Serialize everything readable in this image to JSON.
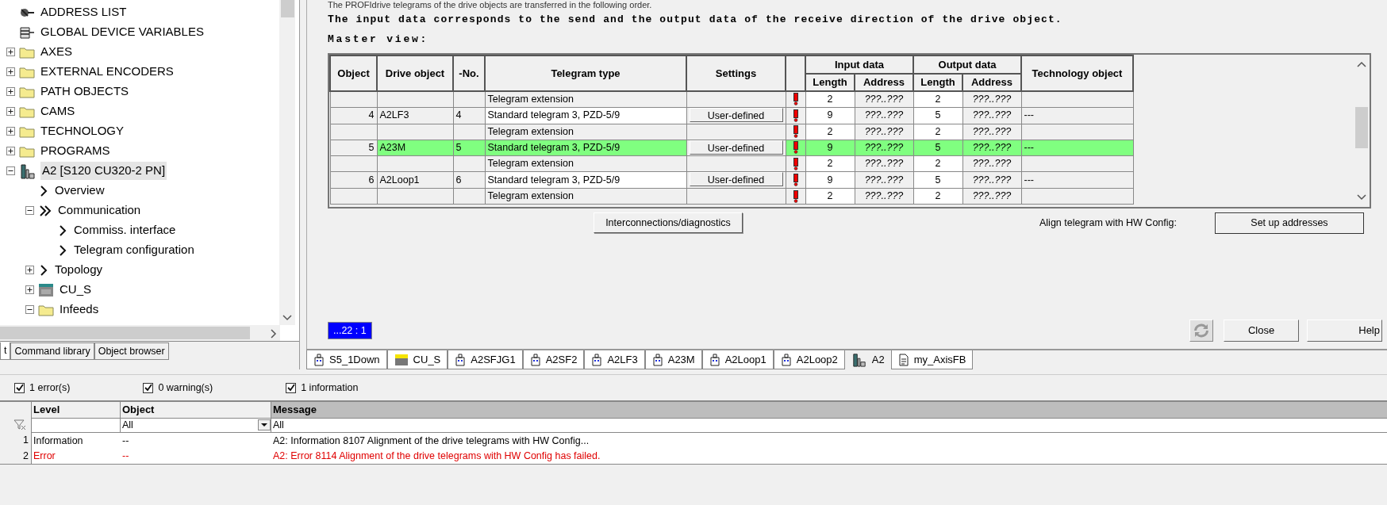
{
  "tree": [
    {
      "label": "ADDRESS LIST",
      "kind": "address"
    },
    {
      "label": "GLOBAL DEVICE VARIABLES",
      "kind": "database"
    },
    {
      "label": "AXES",
      "kind": "folder",
      "expanded": false
    },
    {
      "label": "EXTERNAL ENCODERS",
      "kind": "folder",
      "expanded": false
    },
    {
      "label": "PATH OBJECTS",
      "kind": "folder",
      "expanded": false
    },
    {
      "label": "CAMS",
      "kind": "folder",
      "expanded": false
    },
    {
      "label": "TECHNOLOGY",
      "kind": "folder",
      "expanded": false
    },
    {
      "label": "PROGRAMS",
      "kind": "folder",
      "expanded": false
    },
    {
      "label": "A2 [S120 CU320-2 PN]",
      "kind": "device",
      "expanded": true,
      "selected": true,
      "children": [
        {
          "label": "Overview",
          "kind": "view"
        },
        {
          "label": "Communication",
          "kind": "group",
          "expanded": true,
          "children": [
            {
              "label": "Commiss. interface",
              "kind": "view"
            },
            {
              "label": "Telegram configuration",
              "kind": "view"
            }
          ]
        },
        {
          "label": "Topology",
          "kind": "view",
          "expanded": false
        },
        {
          "label": "CU_S",
          "kind": "cu",
          "expanded": false
        },
        {
          "label": "Infeeds",
          "kind": "folder",
          "expanded": true
        }
      ]
    }
  ],
  "left_tabs": [
    {
      "label": "t",
      "selected": true
    },
    {
      "label": "Command library",
      "selected": false
    },
    {
      "label": "Object browser",
      "selected": false
    }
  ],
  "intro_lines": [
    "The PROFIdrive telegrams of the drive objects are transferred in the following order.",
    "The input data corresponds to the send and the output data of the receive direction of the drive object.",
    "Master view:"
  ],
  "table": {
    "columns": [
      "Object",
      "Drive object",
      "-No.",
      "Telegram type",
      "Settings",
      "Input data",
      "Output data",
      "Technology object"
    ],
    "subcolumns": [
      "Length",
      "Address",
      "Length",
      "Address"
    ],
    "rows": [
      {
        "kind": "extension",
        "object": "",
        "drive_object": "",
        "no": "",
        "telegram_type": "Telegram extension",
        "in_len": "2",
        "in_addr": "???..???",
        "out_len": "2",
        "out_addr": "???..???",
        "tech": "",
        "selected": false
      },
      {
        "kind": "main",
        "object": "4",
        "drive_object": "A2LF3",
        "no": "4",
        "telegram_type": "Standard telegram 3, PZD-5/9",
        "settings": "User-defined",
        "in_len": "9",
        "in_addr": "???..???",
        "out_len": "5",
        "out_addr": "???..???",
        "tech": "---",
        "selected": false
      },
      {
        "kind": "extension",
        "object": "",
        "drive_object": "",
        "no": "",
        "telegram_type": "Telegram extension",
        "in_len": "2",
        "in_addr": "???..???",
        "out_len": "2",
        "out_addr": "???..???",
        "tech": "",
        "selected": false
      },
      {
        "kind": "main",
        "object": "5",
        "drive_object": "A23M",
        "no": "5",
        "telegram_type": "Standard telegram 3, PZD-5/9",
        "settings": "User-defined",
        "in_len": "9",
        "in_addr": "???..???",
        "out_len": "5",
        "out_addr": "???..???",
        "tech": "---",
        "selected": true
      },
      {
        "kind": "extension",
        "object": "",
        "drive_object": "",
        "no": "",
        "telegram_type": "Telegram extension",
        "in_len": "2",
        "in_addr": "???..???",
        "out_len": "2",
        "out_addr": "???..???",
        "tech": "",
        "selected": false
      },
      {
        "kind": "main",
        "object": "6",
        "drive_object": "A2Loop1",
        "no": "6",
        "telegram_type": "Standard telegram 3, PZD-5/9",
        "settings": "User-defined",
        "in_len": "9",
        "in_addr": "???..???",
        "out_len": "5",
        "out_addr": "???..???",
        "tech": "---",
        "selected": false
      },
      {
        "kind": "extension",
        "object": "",
        "drive_object": "",
        "no": "",
        "telegram_type": "Telegram extension",
        "in_len": "2",
        "in_addr": "???..???",
        "out_len": "2",
        "out_addr": "???..???",
        "tech": "",
        "selected": false
      }
    ]
  },
  "diagnostics_button": "Interconnections/diagnostics",
  "align_label": "Align telegram with HW Config:",
  "setup_button": "Set up addresses",
  "position_indicator": "...22 : 1",
  "close_button": "Close",
  "help_button": "Help",
  "editor_tabs": [
    {
      "label": "S5_1Down",
      "kind": "drive",
      "selected": false
    },
    {
      "label": "CU_S",
      "kind": "cu",
      "selected": false
    },
    {
      "label": "A2SFJG1",
      "kind": "drive",
      "selected": false
    },
    {
      "label": "A2SF2",
      "kind": "drive",
      "selected": false
    },
    {
      "label": "A2LF3",
      "kind": "drive",
      "selected": false
    },
    {
      "label": "A23M",
      "kind": "drive",
      "selected": false
    },
    {
      "label": "A2Loop1",
      "kind": "drive",
      "selected": false
    },
    {
      "label": "A2Loop2",
      "kind": "drive",
      "selected": false
    },
    {
      "label": "A2",
      "kind": "device",
      "selected": true
    },
    {
      "label": "my_AxisFB",
      "kind": "document",
      "selected": false
    }
  ],
  "filters": [
    {
      "label": "1 error(s)",
      "checked": true
    },
    {
      "label": "0 warning(s)",
      "checked": true
    },
    {
      "label": "1 information",
      "checked": true
    }
  ],
  "log": {
    "columns": [
      "Level",
      "Object",
      "Message"
    ],
    "filter_values": [
      "All",
      "All"
    ],
    "rows": [
      {
        "kind": "information",
        "index": "1",
        "level": "Information",
        "object": "--",
        "message": "A2: Information 8107 Alignment of the drive telegrams with HW Config..."
      },
      {
        "kind": "error",
        "index": "2",
        "level": "Error",
        "object": "--",
        "message": "A2: Error 8114 Alignment of the drive telegrams with HW Config has failed."
      }
    ]
  }
}
